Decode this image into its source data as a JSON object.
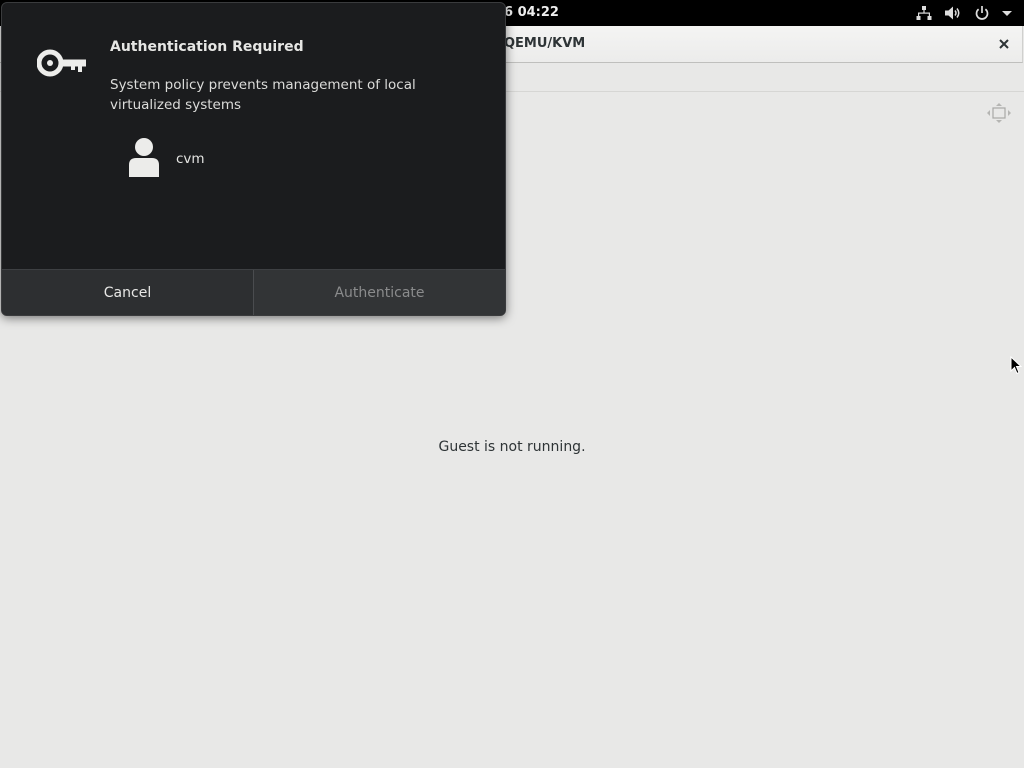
{
  "topbar": {
    "clock": "6  04:22",
    "icons": [
      "network-icon",
      "volume-icon",
      "power-icon",
      "menu-arrow-icon"
    ]
  },
  "window": {
    "title": "QEMU/KVM",
    "status": "Guest is not running."
  },
  "dialog": {
    "title": "Authentication Required",
    "message": "System policy prevents management of local virtualized systems",
    "user": "cvm",
    "cancel_label": "Cancel",
    "authenticate_label": "Authenticate"
  },
  "colors": {
    "dialog_bg": "#1b1c1e",
    "button_bg": "#2d2f31",
    "window_bg": "#e8e8e7",
    "topbar_bg": "#000000"
  }
}
